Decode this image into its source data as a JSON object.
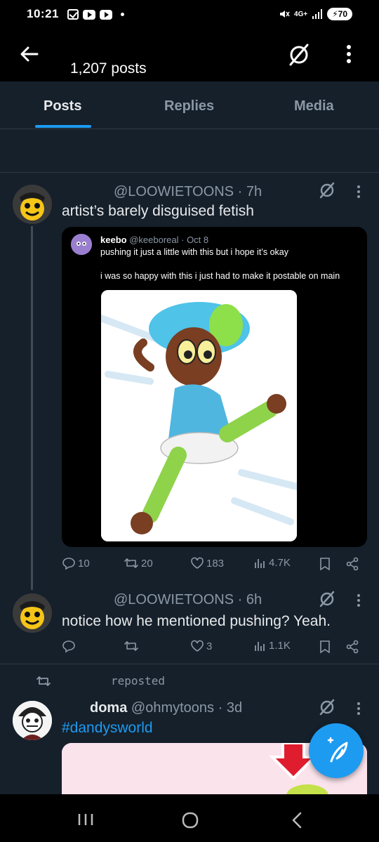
{
  "status_bar": {
    "time": "10:21",
    "network": "4G+",
    "battery": "70"
  },
  "header": {
    "post_count": "1,207 posts"
  },
  "tabs": [
    {
      "label": "Posts",
      "active": true
    },
    {
      "label": "Replies",
      "active": false
    },
    {
      "label": "Media",
      "active": false
    }
  ],
  "tweets": [
    {
      "handle": "@LOOWIETOONS",
      "time": "· 7h",
      "text": "artist’s barely disguised fetish",
      "quote": {
        "name": "keebo",
        "handle": "@keeboreal",
        "time": "· Oct 8",
        "line1": "pushing it just a little with this but i hope it’s okay",
        "line2": "i was so happy with this i just had to make it postable on main"
      },
      "stats": {
        "replies": "10",
        "reposts": "20",
        "likes": "183",
        "views": "4.7K"
      }
    },
    {
      "handle": "@LOOWIETOONS",
      "time": "· 6h",
      "text": "notice how he mentioned pushing? Yeah.",
      "stats": {
        "replies": "",
        "reposts": "",
        "likes": "3",
        "views": "1.1K"
      }
    },
    {
      "repost_label": "reposted",
      "name": "doma",
      "handle": "@ohmytoons",
      "time": "· 3d",
      "text": "#dandysworld"
    }
  ],
  "colors": {
    "background": "#15202b",
    "accent": "#1d9bf0",
    "muted": "#8b98a5"
  }
}
